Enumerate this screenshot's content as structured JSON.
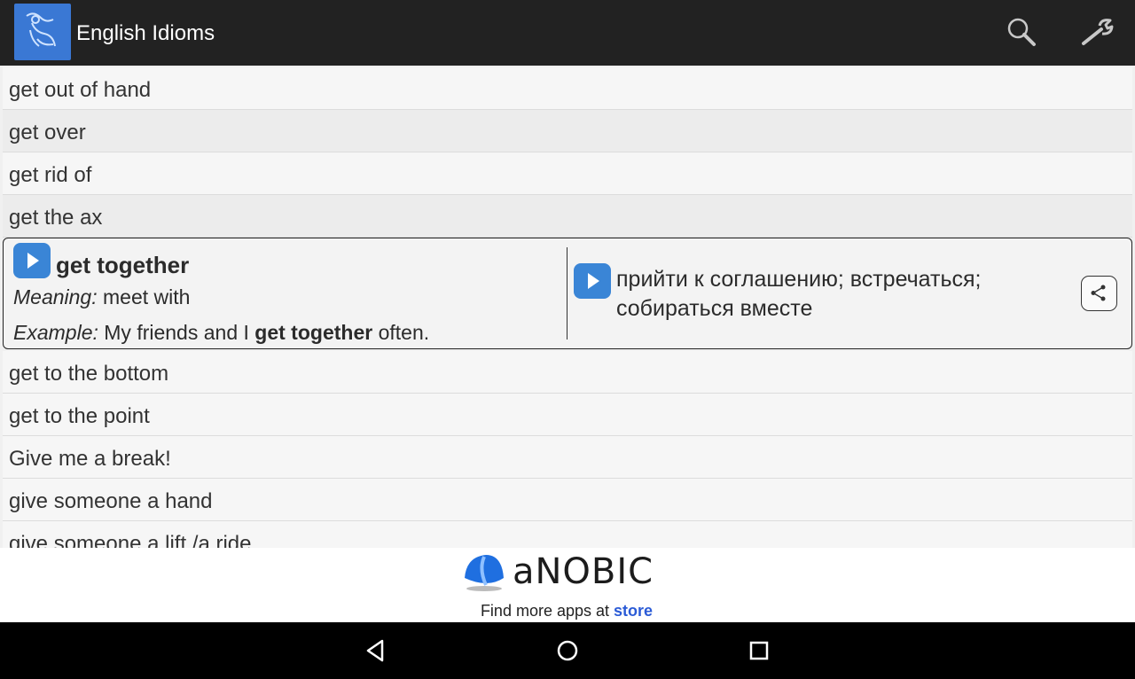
{
  "app": {
    "title": "English Idioms"
  },
  "toolbar": {
    "search_icon": "search-icon",
    "settings_icon": "wrench-icon"
  },
  "list": {
    "items_above": [
      "get out of hand",
      "get over",
      "get rid of",
      "get the ax"
    ],
    "expanded": {
      "idiom": "get together",
      "meaning_label": "Meaning:",
      "meaning": "meet with",
      "example_label": "Example:",
      "example_before": "My friends and I",
      "example_highlight": "get together",
      "example_after": "often.",
      "translation": "прийти к соглашению; встречаться; собираться вместе"
    },
    "items_below": [
      "get to the bottom",
      "get to the point",
      "Give me a break!",
      "give someone a hand",
      "give someone a lift /a ride"
    ]
  },
  "ad": {
    "brand": "aNOBIC",
    "tagline_prefix": "Find more apps at",
    "tagline_link": "store"
  },
  "colors": {
    "accent": "#3a85d6",
    "appbar": "#222222",
    "link": "#2b5bd6"
  }
}
